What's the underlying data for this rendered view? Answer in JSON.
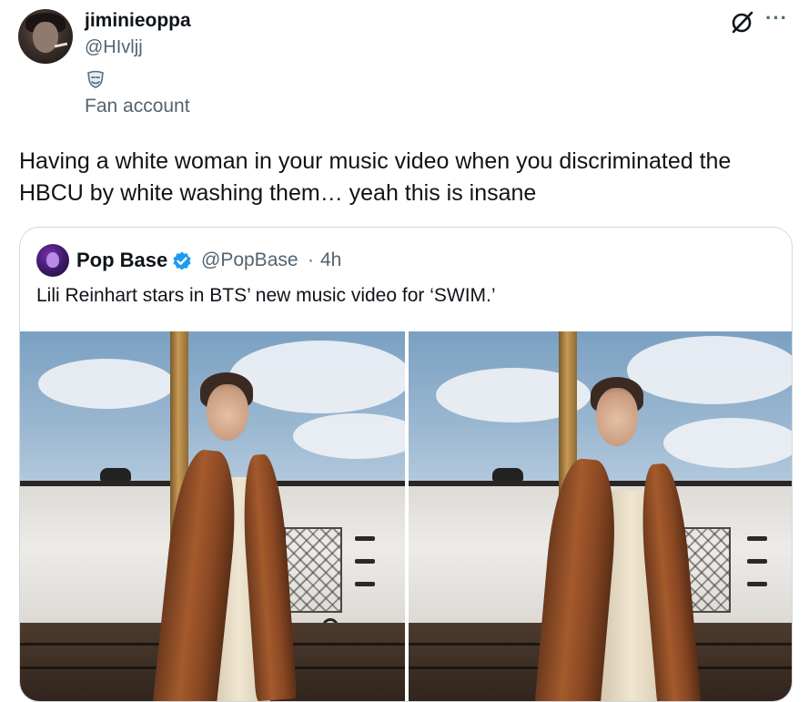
{
  "post": {
    "author_name": "jiminieoppa",
    "author_handle": "@HIvljj",
    "affiliation_label": "Fan account",
    "text": "Having a white woman in your music video when you discriminated the HBCU by white washing them… yeah this is insane"
  },
  "quoted": {
    "author_name": "Pop Base",
    "author_handle": "@PopBase",
    "separator": "·",
    "time": "4h",
    "text": "Lili Reinhart stars in BTS’ new music video for ‘SWIM.’"
  },
  "icons": {
    "verified": "verified-badge-icon",
    "affiliation": "theater-masks-icon",
    "grok": "grok-icon",
    "more": "more-options-icon"
  },
  "colors": {
    "text_primary": "#0f1419",
    "text_secondary": "#536471",
    "verified_blue": "#1d9bf0",
    "border": "#cfd9de"
  }
}
